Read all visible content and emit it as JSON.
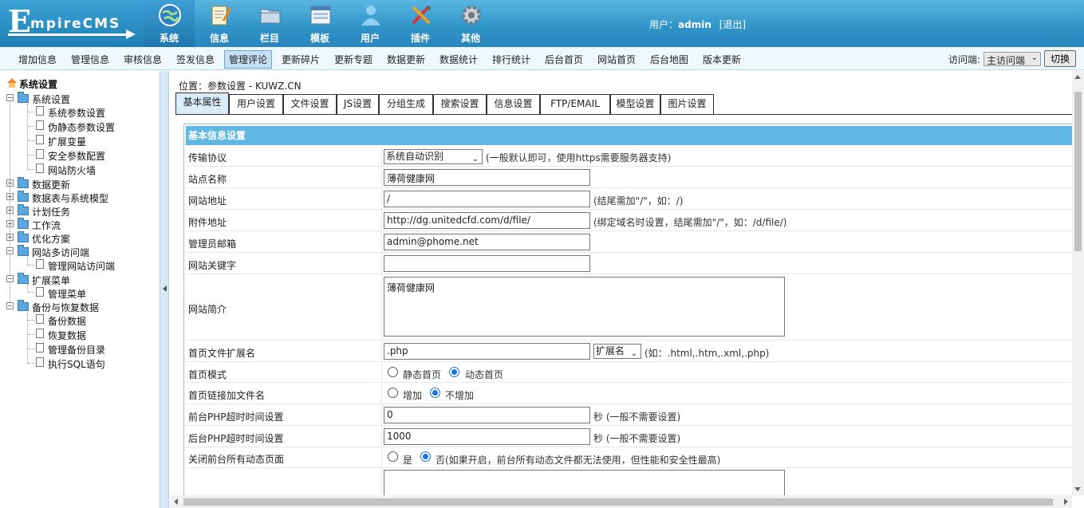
{
  "logo": {
    "first": "E",
    "rest": "mpireCMS"
  },
  "nav": [
    {
      "label": "系统",
      "icon": "globe-icon"
    },
    {
      "label": "信息",
      "icon": "notepad-icon"
    },
    {
      "label": "栏目",
      "icon": "folder-icon"
    },
    {
      "label": "模板",
      "icon": "window-icon"
    },
    {
      "label": "用户",
      "icon": "user-icon"
    },
    {
      "label": "插件",
      "icon": "tools-icon"
    },
    {
      "label": "其他",
      "icon": "gear-icon"
    }
  ],
  "user": {
    "prefix": "用户：",
    "name": "admin",
    "logout": "[退出]"
  },
  "submenu": [
    "增加信息",
    "管理信息",
    "审核信息",
    "签发信息",
    "管理评论",
    "更新碎片",
    "更新专题",
    "数据更新",
    "数据统计",
    "排行统计",
    "后台首页",
    "网站首页",
    "后台地图",
    "版本更新"
  ],
  "visit": {
    "label": "访问端:",
    "selected": "主访问端",
    "button": "切换"
  },
  "tree": {
    "root": "系统设置",
    "items": [
      "系统设置",
      "系统参数设置",
      "伪静态参数设置",
      "扩展变量",
      "安全参数配置",
      "网站防火墙",
      "数据更新",
      "数据表与系统模型",
      "计划任务",
      "工作流",
      "优化方案",
      "网站多访问端",
      "管理网站访问端",
      "扩展菜单",
      "管理菜单",
      "备份与恢复数据",
      "备份数据",
      "恢复数据",
      "管理备份目录",
      "执行SQL语句"
    ]
  },
  "location": "位置：参数设置 - KUWZ.CN",
  "tabs": [
    "基本属性",
    "用户设置",
    "文件设置",
    "JS设置",
    "分组生成",
    "搜索设置",
    "信息设置",
    "FTP/EMAIL",
    "模型设置",
    "图片设置"
  ],
  "section": "基本信息设置",
  "form": {
    "protocol_label": "传输协议",
    "protocol_value": "系统自动识别",
    "protocol_note": "(一般默认即可，使用https需要服务器支持)",
    "sitename_label": "站点名称",
    "sitename_value": "薄荷健康网",
    "siteurl_label": "网站地址",
    "siteurl_value": "/",
    "siteurl_note": "(结尾需加\"/\"，如：/)",
    "fileurl_label": "附件地址",
    "fileurl_value": "http://dg.unitedcfd.com/d/file/",
    "fileurl_note": "(绑定域名时设置，结尾需加\"/\"，如：/d/file/)",
    "email_label": "管理员邮箱",
    "email_value": "admin@phome.net",
    "keywords_label": "网站关键字",
    "keywords_value": "",
    "intro_label": "网站简介",
    "intro_value": "薄荷健康网",
    "ext_label": "首页文件扩展名",
    "ext_value": ".php",
    "ext_select": "扩展名",
    "ext_note": "(如：.html,.htm,.xml,.php)",
    "mode_label": "首页模式",
    "mode_opt1": "静态首页",
    "mode_opt2": "动态首页",
    "link_label": "首页链接加文件名",
    "link_opt1": "增加",
    "link_opt2": "不增加",
    "fphp_label": "前台PHP超时时间设置",
    "fphp_value": "0",
    "fphp_note": "秒 (一般不需要设置)",
    "bphp_label": "后台PHP超时时间设置",
    "bphp_value": "1000",
    "bphp_note": "秒 (一般不需要设置)",
    "close_label": "关闭前台所有动态页面",
    "close_opt1": "是",
    "close_opt2": "否(如果开启，前台所有动态文件都无法使用，但性能和安全性最高)"
  }
}
